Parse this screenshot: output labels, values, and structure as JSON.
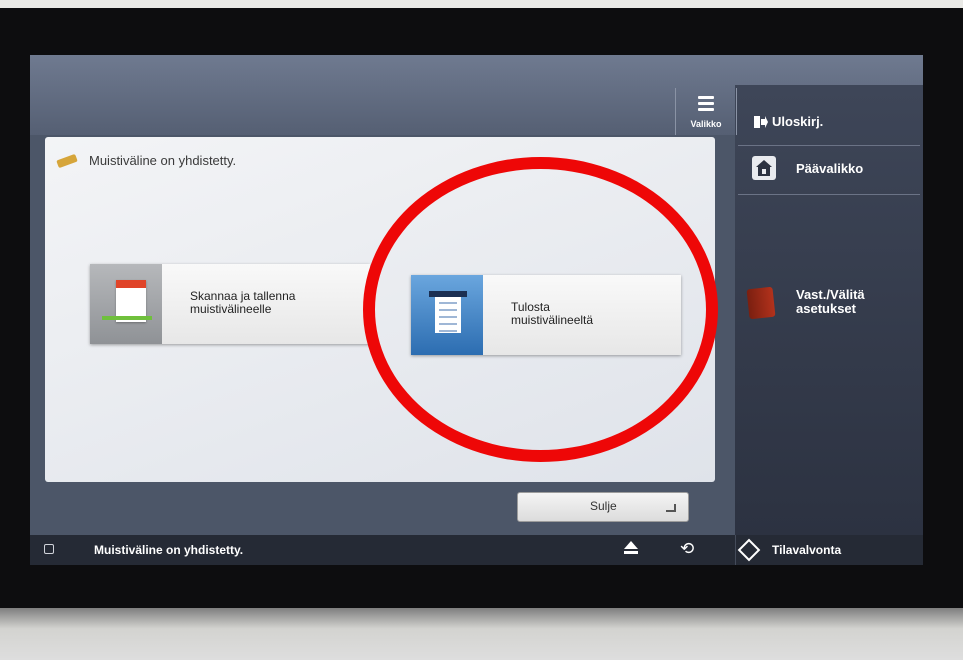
{
  "header": {
    "menu_label": "Valikko",
    "logout_label": "Uloskirj."
  },
  "right_panel": {
    "home_label": "Päävalikko",
    "settings_line1": "Vast./Välitä",
    "settings_line2": "asetukset"
  },
  "main": {
    "connected_message": "Muistiväline on yhdistetty.",
    "tiles": [
      {
        "line1": "Skannaa ja tallenna",
        "line2": "muistivälineelle"
      },
      {
        "line1": "Tulosta",
        "line2": "muistivälineeltä"
      }
    ],
    "close_label": "Sulje"
  },
  "statusbar": {
    "message": "Muistiväline on yhdistetty.",
    "monitor_label": "Tilavalvonta"
  },
  "colors": {
    "annotation": "#ee0707",
    "accent_blue": "#2c6db1"
  }
}
